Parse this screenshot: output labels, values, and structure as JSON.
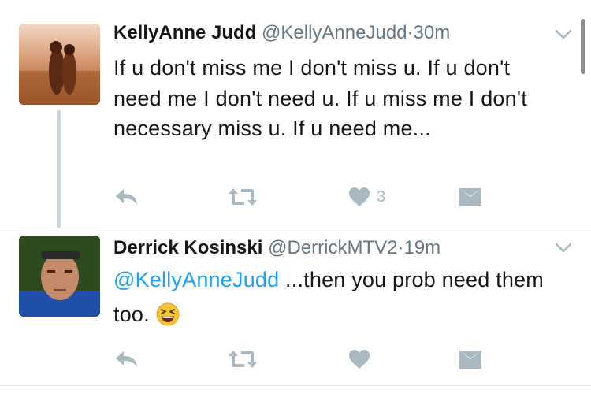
{
  "tweets": [
    {
      "name": "KellyAnne Judd",
      "handle": "@KellyAnneJudd",
      "separator": "·",
      "time": "30m",
      "text": "If u don't miss me I don't miss u. If u don't need me I don't need u. If u miss me I don't necessary miss u. If u need me...",
      "actions": {
        "reply_count": "",
        "retweet_count": "",
        "like_count": "3"
      }
    },
    {
      "name": "Derrick Kosinski",
      "handle": "@DerrickMTV2",
      "separator": "·",
      "time": "19m",
      "mention": "@KellyAnneJudd",
      "text": " ...then you prob need them too.",
      "emoji": "grinning-squinting-face",
      "actions": {
        "reply_count": "",
        "retweet_count": "",
        "like_count": ""
      }
    }
  ],
  "colors": {
    "link": "#1da1f2",
    "secondary_text": "#657786",
    "icon": "#aab8c2",
    "thread_line": "#ccd6dd"
  },
  "icons": [
    "reply-icon",
    "retweet-icon",
    "heart-icon",
    "direct-message-icon",
    "chevron-down-icon"
  ]
}
